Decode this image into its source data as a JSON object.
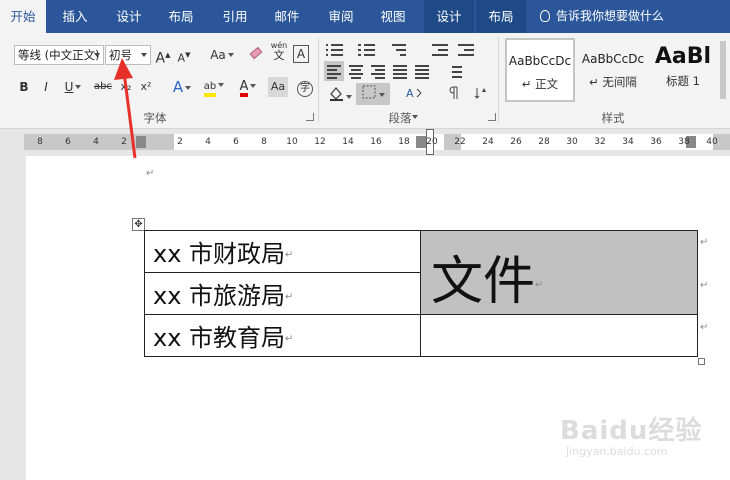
{
  "tabs": [
    {
      "label": "开始",
      "active": true
    },
    {
      "label": "插入"
    },
    {
      "label": "设计"
    },
    {
      "label": "布局"
    },
    {
      "label": "引用"
    },
    {
      "label": "邮件"
    },
    {
      "label": "审阅"
    },
    {
      "label": "视图"
    },
    {
      "label": "设计",
      "contextual": true
    },
    {
      "label": "布局",
      "contextual": true
    }
  ],
  "tell_me": "告诉我你想要做什么",
  "font_group": {
    "font_name": "等线 (中文正文)",
    "font_size": "初号",
    "grow_label": "A",
    "shrink_label": "A",
    "case_label": "Aa",
    "wen_label": "wén",
    "wen_char": "文",
    "border_char": "A",
    "bold": "B",
    "italic": "I",
    "underline": "U",
    "strike": "abc",
    "subscript": "x₂",
    "superscript": "x²",
    "effect_char": "A",
    "highlight_char": "ab",
    "font_color_char": "A",
    "aa_char": "Aa",
    "circle_char": "字",
    "label": "字体"
  },
  "para_group": {
    "label": "段落"
  },
  "styles_group": {
    "label": "样式",
    "items": [
      {
        "preview": "AaBbCcDc",
        "name": "↵ 正文"
      },
      {
        "preview": "AaBbCcDc",
        "name": "↵ 无间隔"
      },
      {
        "preview": "AaBl",
        "name": "标题 1"
      }
    ]
  },
  "ruler": {
    "left_ticks": [
      "8",
      "6",
      "4",
      "2"
    ],
    "right_ticks": [
      "2",
      "4",
      "6",
      "8",
      "10",
      "12",
      "14",
      "16",
      "18",
      "20",
      "22",
      "24",
      "26",
      "28",
      "30",
      "32",
      "34",
      "36",
      "38",
      "40"
    ]
  },
  "document": {
    "paragraph_mark": "↵",
    "table": {
      "rows": [
        "xx 市财政局",
        "xx 市旅游局",
        "xx 市教育局"
      ],
      "merged_cell": "文件"
    }
  },
  "watermark": {
    "main": "Baidu经验",
    "sub": "jingyan.baidu.com"
  },
  "colors": {
    "tab_bar": "#2b579a",
    "highlight_yellow": "#ffe600",
    "font_red": "#e00000",
    "arrow_red": "#e8302a",
    "cell_gray": "#c1c1c1"
  }
}
